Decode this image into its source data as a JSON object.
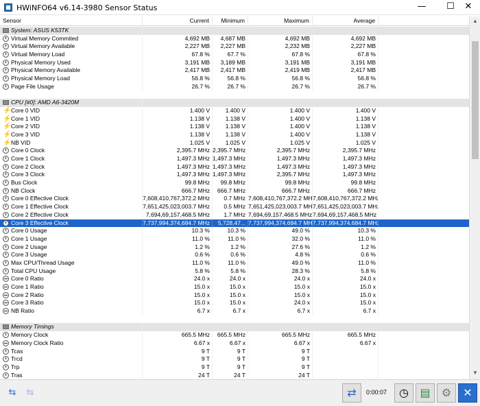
{
  "window": {
    "title": "HWiNFO64 v6.14-3980 Sensor Status",
    "min_glyph": "—",
    "max_glyph": "☐",
    "close_glyph": "✕"
  },
  "columns": [
    "Sensor",
    "Current",
    "Minimum",
    "Maximum",
    "Average"
  ],
  "rows": [
    {
      "kind": "group",
      "name": "System: ASUS K53TK"
    },
    {
      "kind": "data",
      "icon": "clock",
      "name": "Virtual Memory Commited",
      "cur": "4,692 MB",
      "min": "4,687 MB",
      "max": "4,692 MB",
      "avg": "4,692 MB"
    },
    {
      "kind": "data",
      "icon": "clock",
      "name": "Virtual Memory Available",
      "cur": "2,227 MB",
      "min": "2,227 MB",
      "max": "2,232 MB",
      "avg": "2,227 MB"
    },
    {
      "kind": "data",
      "icon": "clock",
      "name": "Virtual Memory Load",
      "cur": "67.8 %",
      "min": "67.7 %",
      "max": "67.8 %",
      "avg": "67.8 %"
    },
    {
      "kind": "data",
      "icon": "clock",
      "name": "Physical Memory Used",
      "cur": "3,191 MB",
      "min": "3,189 MB",
      "max": "3,191 MB",
      "avg": "3,191 MB"
    },
    {
      "kind": "data",
      "icon": "clock",
      "name": "Physical Memory Available",
      "cur": "2,417 MB",
      "min": "2,417 MB",
      "max": "2,419 MB",
      "avg": "2,417 MB"
    },
    {
      "kind": "data",
      "icon": "clock",
      "name": "Physical Memory Load",
      "cur": "56.8 %",
      "min": "56.8 %",
      "max": "56.8 %",
      "avg": "56.8 %"
    },
    {
      "kind": "data",
      "icon": "clock",
      "name": "Page File Usage",
      "cur": "26.7 %",
      "min": "26.7 %",
      "max": "26.7 %",
      "avg": "26.7 %"
    },
    {
      "kind": "blank"
    },
    {
      "kind": "group",
      "name": "CPU [#0]: AMD A6-3420M"
    },
    {
      "kind": "data",
      "icon": "bolt",
      "name": "Core 0 VID",
      "cur": "1.400 V",
      "min": "1.400 V",
      "max": "1.400 V",
      "avg": "1.400 V"
    },
    {
      "kind": "data",
      "icon": "bolt",
      "name": "Core 1 VID",
      "cur": "1.138 V",
      "min": "1.138 V",
      "max": "1.400 V",
      "avg": "1.138 V"
    },
    {
      "kind": "data",
      "icon": "bolt",
      "name": "Core 2 VID",
      "cur": "1.138 V",
      "min": "1.138 V",
      "max": "1.400 V",
      "avg": "1.138 V"
    },
    {
      "kind": "data",
      "icon": "bolt",
      "name": "Core 3 VID",
      "cur": "1.138 V",
      "min": "1.138 V",
      "max": "1.400 V",
      "avg": "1.138 V"
    },
    {
      "kind": "data",
      "icon": "bolt",
      "name": "NB VID",
      "cur": "1.025 V",
      "min": "1.025 V",
      "max": "1.025 V",
      "avg": "1.025 V"
    },
    {
      "kind": "data",
      "icon": "clock",
      "name": "Core 0 Clock",
      "cur": "2,395.7 MHz",
      "min": "2,395.7 MHz",
      "max": "2,395.7 MHz",
      "avg": "2,395.7 MHz"
    },
    {
      "kind": "data",
      "icon": "clock",
      "name": "Core 1 Clock",
      "cur": "1,497.3 MHz",
      "min": "1,497.3 MHz",
      "max": "1,497.3 MHz",
      "avg": "1,497.3 MHz"
    },
    {
      "kind": "data",
      "icon": "clock",
      "name": "Core 2 Clock",
      "cur": "1,497.3 MHz",
      "min": "1,497.3 MHz",
      "max": "1,497.3 MHz",
      "avg": "1,497.3 MHz"
    },
    {
      "kind": "data",
      "icon": "clock",
      "name": "Core 3 Clock",
      "cur": "1,497.3 MHz",
      "min": "1,497.3 MHz",
      "max": "2,395.7 MHz",
      "avg": "1,497.3 MHz"
    },
    {
      "kind": "data",
      "icon": "clock",
      "name": "Bus Clock",
      "cur": "99.8 MHz",
      "min": "99.8 MHz",
      "max": "99.8 MHz",
      "avg": "99.8 MHz"
    },
    {
      "kind": "data",
      "icon": "clock",
      "name": "NB Clock",
      "cur": "666.7 MHz",
      "min": "666.7 MHz",
      "max": "666.7 MHz",
      "avg": "666.7 MHz"
    },
    {
      "kind": "data",
      "icon": "clock",
      "name": "Core 0 Effective Clock",
      "cur": "7,608,410,767,372.2 MHz",
      "min": "0.7 MHz",
      "max": "7,608,410,767,372.2 MHz",
      "avg": "7,608,410,767,372.2 MHz"
    },
    {
      "kind": "data",
      "icon": "clock",
      "name": "Core 1 Effective Clock",
      "cur": "7,651,425,023,003.7 MHz",
      "min": "0.5 MHz",
      "max": "7,651,425,023,003.7 MHz",
      "avg": "7,651,425,023,003.7 MHz"
    },
    {
      "kind": "data",
      "icon": "clock",
      "name": "Core 2 Effective Clock",
      "cur": "7,694,69,157,468.5 MHz",
      "min": "1.7 MHz",
      "max": "7,694,69,157,468.5 MHz",
      "avg": "7,694,69,157,468.5 MHz"
    },
    {
      "kind": "data",
      "icon": "clock",
      "name": "Core 3 Effective Clock",
      "cur": "7,737,994,374,684.7 MHz",
      "min": "5,728,47...",
      "max": "7,737,994,374,684.7 MHz",
      "avg": "7,737,994,374,684.7 MHz",
      "selected": true
    },
    {
      "kind": "data",
      "icon": "clock",
      "name": "Core 0 Usage",
      "cur": "10.3 %",
      "min": "10.3 %",
      "max": "49.0 %",
      "avg": "10.3 %"
    },
    {
      "kind": "data",
      "icon": "clock",
      "name": "Core 1 Usage",
      "cur": "11.0 %",
      "min": "11.0 %",
      "max": "32.0 %",
      "avg": "11.0 %"
    },
    {
      "kind": "data",
      "icon": "clock",
      "name": "Core 2 Usage",
      "cur": "1.2 %",
      "min": "1.2 %",
      "max": "27.6 %",
      "avg": "1.2 %"
    },
    {
      "kind": "data",
      "icon": "clock",
      "name": "Core 3 Usage",
      "cur": "0.6 %",
      "min": "0.6 %",
      "max": "4.8 %",
      "avg": "0.6 %"
    },
    {
      "kind": "data",
      "icon": "clock",
      "name": "Max CPU/Thread Usage",
      "cur": "11.0 %",
      "min": "11.0 %",
      "max": "49.0 %",
      "avg": "11.0 %"
    },
    {
      "kind": "data",
      "icon": "clock",
      "name": "Total CPU Usage",
      "cur": "5.8 %",
      "min": "5.8 %",
      "max": "28.3 %",
      "avg": "5.8 %"
    },
    {
      "kind": "data",
      "icon": "ratio",
      "name": "Core 0 Ratio",
      "cur": "24.0 x",
      "min": "24.0 x",
      "max": "24.0 x",
      "avg": "24.0 x"
    },
    {
      "kind": "data",
      "icon": "ratio",
      "name": "Core 1 Ratio",
      "cur": "15.0 x",
      "min": "15.0 x",
      "max": "15.0 x",
      "avg": "15.0 x"
    },
    {
      "kind": "data",
      "icon": "ratio",
      "name": "Core 2 Ratio",
      "cur": "15.0 x",
      "min": "15.0 x",
      "max": "15.0 x",
      "avg": "15.0 x"
    },
    {
      "kind": "data",
      "icon": "ratio",
      "name": "Core 3 Ratio",
      "cur": "15.0 x",
      "min": "15.0 x",
      "max": "24.0 x",
      "avg": "15.0 x"
    },
    {
      "kind": "data",
      "icon": "ratio",
      "name": "NB Ratio",
      "cur": "6.7 x",
      "min": "6.7 x",
      "max": "6.7 x",
      "avg": "6.7 x"
    },
    {
      "kind": "blank"
    },
    {
      "kind": "group",
      "name": "Memory Timings"
    },
    {
      "kind": "data",
      "icon": "clock",
      "name": "Memory Clock",
      "cur": "665.5 MHz",
      "min": "665.5 MHz",
      "max": "665.5 MHz",
      "avg": "665.5 MHz"
    },
    {
      "kind": "data",
      "icon": "ratio",
      "name": "Memory Clock Ratio",
      "cur": "6.67 x",
      "min": "6.67 x",
      "max": "6.67 x",
      "avg": "6.67 x"
    },
    {
      "kind": "data",
      "icon": "clock",
      "name": "Tcas",
      "cur": "9 T",
      "min": "9 T",
      "max": "9 T",
      "avg": ""
    },
    {
      "kind": "data",
      "icon": "clock",
      "name": "Trcd",
      "cur": "9 T",
      "min": "9 T",
      "max": "9 T",
      "avg": ""
    },
    {
      "kind": "data",
      "icon": "clock",
      "name": "Trp",
      "cur": "9 T",
      "min": "9 T",
      "max": "9 T",
      "avg": ""
    },
    {
      "kind": "data",
      "icon": "clock",
      "name": "Tras",
      "cur": "24 T",
      "min": "24 T",
      "max": "24 T",
      "avg": ""
    }
  ],
  "footer": {
    "nav_left_glyph": "⇆",
    "nav_right_glyph": "⇆",
    "network_glyph": "⇄",
    "elapsed": "0:00:07",
    "clock_glyph": "◷",
    "log_glyph": "▤",
    "settings_glyph": "⚙",
    "close_glyph": "✕"
  }
}
